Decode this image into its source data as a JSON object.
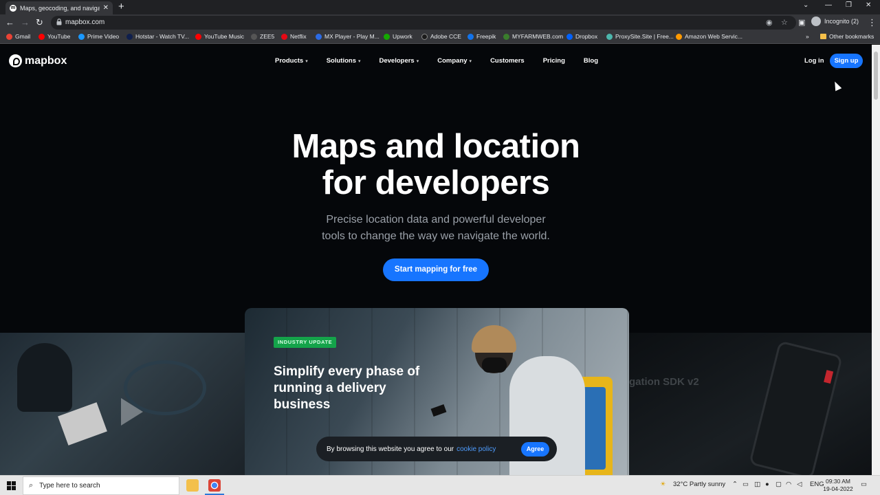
{
  "browser": {
    "tab_title": "Maps, geocoding, and navigation",
    "tab_favicon": "m",
    "url": "mapbox.com",
    "profile_label": "Incognito (2)",
    "other_bookmarks": "Other bookmarks",
    "bookmarks": [
      {
        "label": "Gmail",
        "color": "#ea4335"
      },
      {
        "label": "YouTube",
        "color": "#ff0000"
      },
      {
        "label": "Prime Video",
        "color": "#1a98ff"
      },
      {
        "label": "Hotstar - Watch TV...",
        "color": "#0f1f4d"
      },
      {
        "label": "YouTube Music",
        "color": "#ff0000"
      },
      {
        "label": "ZEE5",
        "color": "#222222"
      },
      {
        "label": "Netflix",
        "color": "#e50914"
      },
      {
        "label": "MX Player - Play M...",
        "color": "#2b6be6"
      },
      {
        "label": "Upwork",
        "color": "#14a800"
      },
      {
        "label": "Adobe CCE",
        "color": "#1b1b1b"
      },
      {
        "label": "Freepik",
        "color": "#1273eb"
      },
      {
        "label": "MYFARMWEB.com",
        "color": "#3a7d2c"
      },
      {
        "label": "Dropbox",
        "color": "#0061ff"
      },
      {
        "label": "ProxySite.Site | Free...",
        "color": "#4cb6ac"
      },
      {
        "label": "Amazon Web Servic...",
        "color": "#ff9900"
      }
    ]
  },
  "site": {
    "brand": "mapbox",
    "nav": [
      {
        "label": "Products",
        "dropdown": true
      },
      {
        "label": "Solutions",
        "dropdown": true
      },
      {
        "label": "Developers",
        "dropdown": true
      },
      {
        "label": "Company",
        "dropdown": true
      },
      {
        "label": "Customers",
        "dropdown": false
      },
      {
        "label": "Pricing",
        "dropdown": false
      },
      {
        "label": "Blog",
        "dropdown": false
      }
    ],
    "login": "Log in",
    "signup": "Sign up",
    "hero_title_line1": "Maps and location",
    "hero_title_line2": "for developers",
    "hero_sub_line1": "Precise location data and powerful developer",
    "hero_sub_line2": "tools to change the way we navigate the world.",
    "cta": "Start mapping for free",
    "slide_badge": "INDUSTRY UPDATE",
    "slide_title_line1": "Simplify every phase of",
    "slide_title_line2": "running a delivery",
    "slide_title_line3": "business",
    "slide_right_ghost": "gation SDK v2",
    "cookie_text": "By browsing this website you agree to our",
    "cookie_link": "cookie policy",
    "cookie_agree": "Agree",
    "accent": "#1775ff"
  },
  "taskbar": {
    "search_placeholder": "Type here to search",
    "weather": "32°C  Partly sunny",
    "language": "ENG",
    "time": "09:30 AM",
    "date": "19-04-2022"
  }
}
